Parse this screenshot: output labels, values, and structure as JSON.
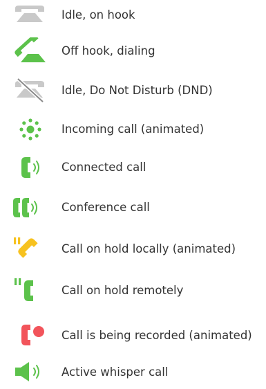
{
  "colors": {
    "idle": "#c9c9c9",
    "active": "#5cc24b",
    "hold_local": "#f7c21f",
    "recording": "#f2545b",
    "text": "#333333"
  },
  "legend": {
    "items": [
      {
        "icon": "phone-idle-icon",
        "label": "Idle, on hook"
      },
      {
        "icon": "phone-off-hook-icon",
        "label": "Off hook, dialing"
      },
      {
        "icon": "phone-dnd-icon",
        "label": "Idle, Do Not Disturb (DND)"
      },
      {
        "icon": "incoming-call-icon",
        "label": "Incoming call (animated)"
      },
      {
        "icon": "connected-call-icon",
        "label": "Connected call"
      },
      {
        "icon": "conference-call-icon",
        "label": "Conference call"
      },
      {
        "icon": "hold-local-icon",
        "label": "Call on hold locally (animated)"
      },
      {
        "icon": "hold-remote-icon",
        "label": "Call on hold remotely"
      },
      {
        "icon": "recording-call-icon",
        "label": "Call is being recorded (animated)"
      },
      {
        "icon": "whisper-call-icon",
        "label": "Active whisper call"
      }
    ]
  }
}
